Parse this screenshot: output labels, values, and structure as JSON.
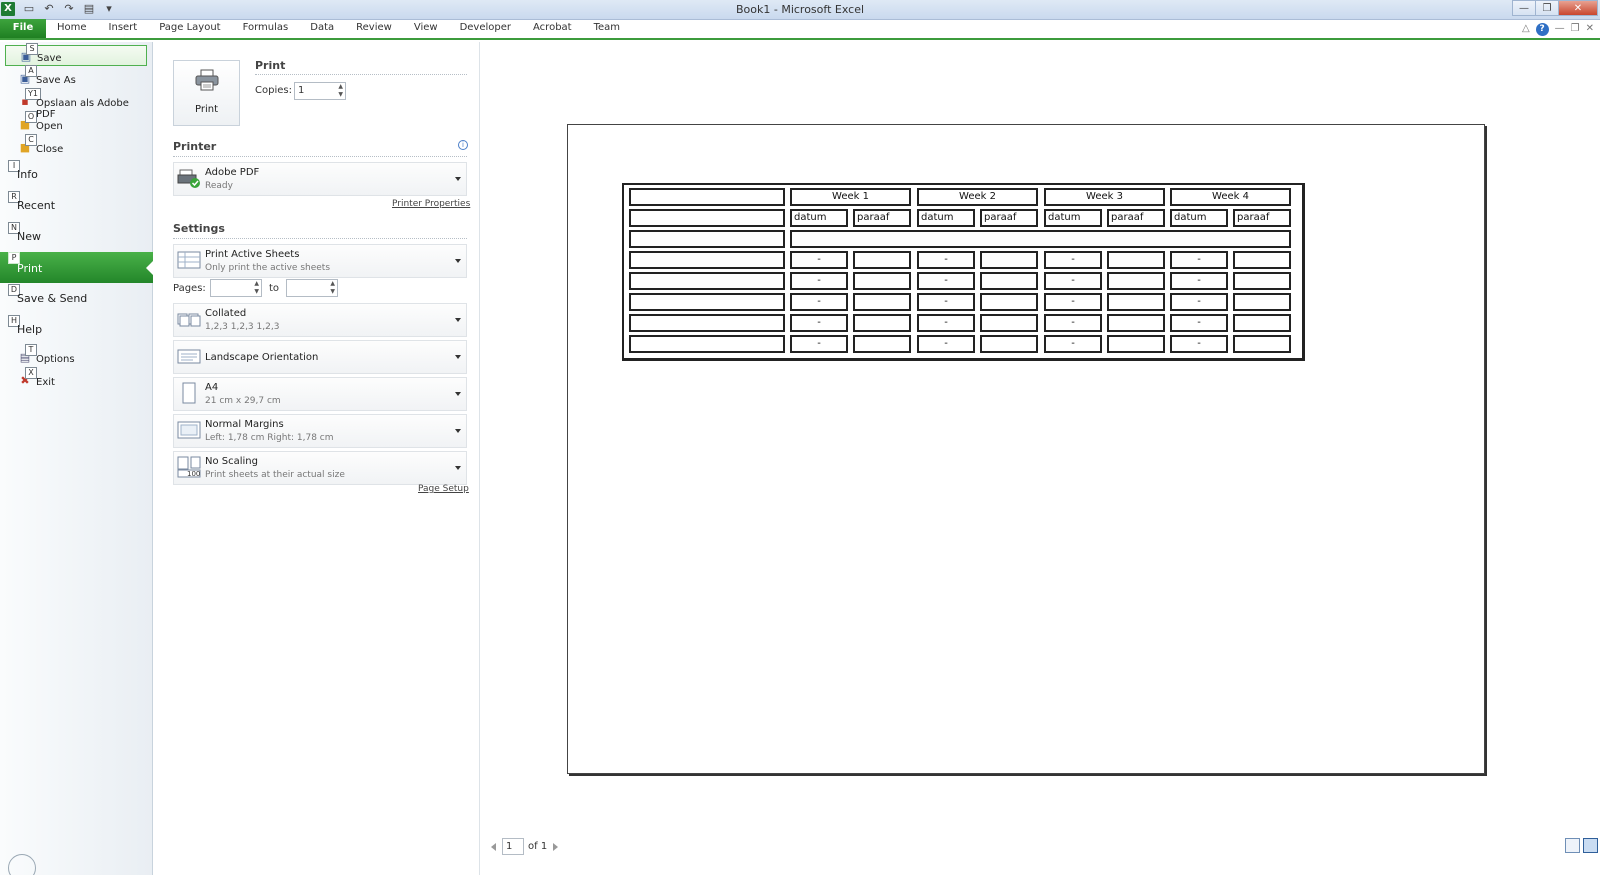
{
  "window": {
    "title": "Book1 - Microsoft Excel",
    "app_icon": "X"
  },
  "ribbon_tabs": [
    "File",
    "Home",
    "Insert",
    "Page Layout",
    "Formulas",
    "Data",
    "Review",
    "View",
    "Developer",
    "Acrobat",
    "Team"
  ],
  "backstage": {
    "commands": [
      {
        "label": "Save",
        "key": "S",
        "icon": "save-icon"
      },
      {
        "label": "Save As",
        "key": "A",
        "icon": "save-as-icon"
      },
      {
        "label": "Opslaan als Adobe PDF",
        "key": "Y1",
        "icon": "pdf-icon"
      },
      {
        "label": "Open",
        "key": "O",
        "icon": "folder-open-icon"
      },
      {
        "label": "Close",
        "key": "C",
        "icon": "folder-close-icon"
      }
    ],
    "sections": [
      {
        "label": "Info",
        "key": "I"
      },
      {
        "label": "Recent",
        "key": "R"
      },
      {
        "label": "New",
        "key": "N"
      },
      {
        "label": "Print",
        "key": "P"
      },
      {
        "label": "Save & Send",
        "key": "D"
      },
      {
        "label": "Help",
        "key": "H"
      }
    ],
    "footer": [
      {
        "label": "Options",
        "key": "T",
        "icon": "options-icon"
      },
      {
        "label": "Exit",
        "key": "X",
        "icon": "exit-icon"
      }
    ]
  },
  "print": {
    "heading": "Print",
    "button_label": "Print",
    "copies_label": "Copies:",
    "copies_value": "1",
    "printer_heading": "Printer",
    "printer_name": "Adobe PDF",
    "printer_status": "Ready",
    "printer_properties": "Printer Properties",
    "settings_heading": "Settings",
    "sheets_main": "Print Active Sheets",
    "sheets_sub": "Only print the active sheets",
    "pages_label": "Pages:",
    "pages_from": "",
    "to_label": "to",
    "pages_to": "",
    "collated_main": "Collated",
    "collated_sub": "1,2,3    1,2,3    1,2,3",
    "orientation_main": "Landscape Orientation",
    "paper_main": "A4",
    "paper_sub": "21 cm x 29,7 cm",
    "margins_main": "Normal Margins",
    "margins_sub": "Left:  1,78 cm    Right:  1,78 cm",
    "scaling_main": "No Scaling",
    "scaling_sub": "Print sheets at their actual size",
    "scaling_badge": "100",
    "page_setup": "Page Setup"
  },
  "preview": {
    "weeks": [
      "Week 1",
      "Week 2",
      "Week 3",
      "Week 4"
    ],
    "subheaders": [
      "datum",
      "paraaf"
    ],
    "dash": "-",
    "data_rows": 5,
    "current_page": "1",
    "of_pages": "of 1"
  }
}
